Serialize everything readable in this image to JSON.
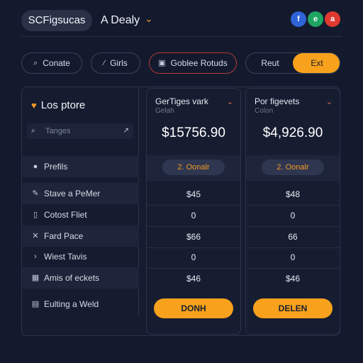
{
  "header": {
    "brand": "SCFigsucas",
    "select_label": "A Dealy",
    "select_caret": "⌄",
    "avatars": [
      {
        "letter": "f",
        "color": "#2f63d8"
      },
      {
        "letter": "e",
        "color": "#1ea564"
      },
      {
        "letter": "a",
        "color": "#e0392f"
      }
    ]
  },
  "toolbar": {
    "buttons": [
      {
        "icon": "search-icon",
        "glyph": "⌕",
        "label": "Conate"
      },
      {
        "icon": "tag-icon",
        "glyph": "⁄",
        "label": "Girls"
      },
      {
        "icon": "lock-icon",
        "glyph": "▣",
        "label": "Goblee Rotuds"
      }
    ],
    "toggle": {
      "left": "Reut",
      "right": "Ext"
    }
  },
  "sidebar": {
    "title": "Los ptore",
    "title_icon": "heart-icon",
    "search_placeholder": "Tanges",
    "items": [
      {
        "icon": "info-icon",
        "glyph": "●",
        "label": "Prefils"
      },
      {
        "icon": "edit-icon",
        "glyph": "✎",
        "label": "Stave a PeMer"
      },
      {
        "icon": "file-icon",
        "glyph": "▯",
        "label": "Cotost Fliet"
      },
      {
        "icon": "close-icon",
        "glyph": "✕",
        "label": "Fard Pace"
      },
      {
        "icon": "arrow-icon",
        "glyph": "›",
        "label": "Wiest Tavis"
      },
      {
        "icon": "chart-icon",
        "glyph": "▦",
        "label": "Amis of eckets"
      },
      {
        "icon": "document-icon",
        "glyph": "▤",
        "label": "Eulting a Weld"
      }
    ]
  },
  "cards": [
    {
      "title": "GerTiges vark",
      "subtitle": "Gelah",
      "price": "$15756.90",
      "chip": "2. Oonalr",
      "values": [
        "$45",
        "0",
        "$66",
        "0",
        "$46"
      ],
      "button": "DONH"
    },
    {
      "title": "Por figevets",
      "subtitle": "Colon",
      "price": "$4,926.90",
      "chip": "2. Oonalr",
      "values": [
        "$48",
        "0",
        "66",
        "0",
        "$46"
      ],
      "button": "DELEN"
    }
  ],
  "colors": {
    "accent": "#f7a11c",
    "background": "#141a2e",
    "surface": "#171d31"
  }
}
